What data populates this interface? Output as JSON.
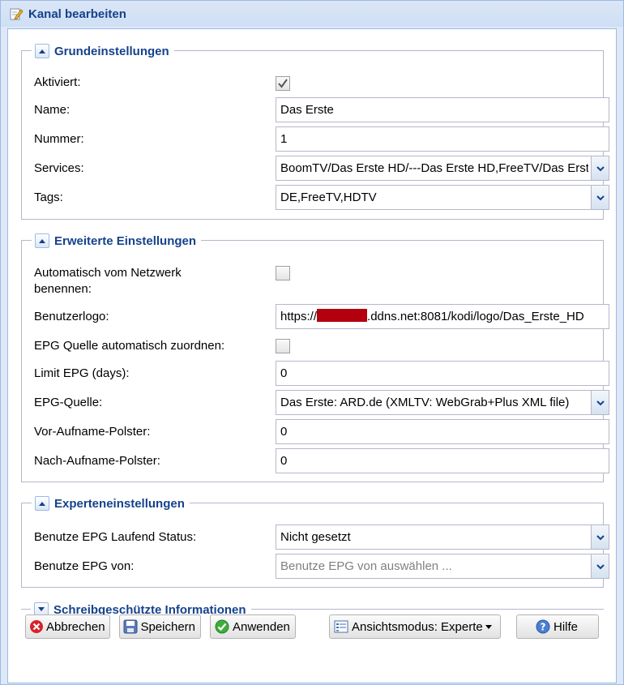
{
  "window": {
    "title": "Kanal bearbeiten"
  },
  "sections": {
    "basic": {
      "title": "Grundeinstellungen",
      "aktiviert": {
        "label": "Aktiviert:",
        "checked": true
      },
      "name": {
        "label": "Name:",
        "value": "Das Erste"
      },
      "nummer": {
        "label": "Nummer:",
        "value": "1"
      },
      "services": {
        "label": "Services:",
        "value": "BoomTV/Das Erste HD/---Das Erste HD,FreeTV/Das Erste HD"
      },
      "tags": {
        "label": "Tags:",
        "value": "DE,FreeTV,HDTV"
      }
    },
    "advanced": {
      "title": "Erweiterte Einstellungen",
      "auto_name": {
        "label_line1": "Automatisch vom Netzwerk",
        "label_line2": "benennen:",
        "checked": false
      },
      "logo": {
        "label": "Benutzerlogo:",
        "value_prefix": "https://",
        "value_suffix": ".ddns.net:8081/kodi/logo/Das_Erste_HD"
      },
      "epg_auto": {
        "label": "EPG Quelle automatisch zuordnen:",
        "checked": false
      },
      "limit_epg": {
        "label": "Limit EPG (days):",
        "value": "0"
      },
      "epg_source": {
        "label": "EPG-Quelle:",
        "value": "Das Erste: ARD.de (XMLTV: WebGrab+Plus XML file)"
      },
      "pre_padding": {
        "label": "Vor-Aufname-Polster:",
        "value": "0"
      },
      "post_padding": {
        "label": "Nach-Aufname-Polster:",
        "value": "0"
      }
    },
    "expert": {
      "title": "Experteneinstellungen",
      "running_status": {
        "label": "Benutze EPG Laufend Status:",
        "value": "Nicht gesetzt"
      },
      "epg_from": {
        "label": "Benutze EPG von:",
        "placeholder": "Benutze EPG von auswählen ..."
      }
    },
    "readonly": {
      "title": "Schreibgeschützte Informationen"
    }
  },
  "buttons": {
    "cancel": "Abbrechen",
    "save": "Speichern",
    "apply": "Anwenden",
    "view_mode": "Ansichtsmodus: Experte",
    "help": "Hilfe"
  },
  "colors": {
    "title_text": "#15428b",
    "border": "#99bbe8",
    "redaction": "#b3000f"
  }
}
